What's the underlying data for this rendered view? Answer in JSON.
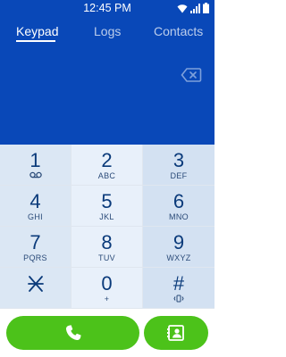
{
  "status_bar": {
    "time": "12:45 PM"
  },
  "tabs": [
    {
      "label": "Keypad"
    },
    {
      "label": "Logs"
    },
    {
      "label": "Contacts"
    }
  ],
  "dial": {
    "number": ""
  },
  "keys": [
    {
      "digit": "1",
      "letters": ""
    },
    {
      "digit": "2",
      "letters": "ABC"
    },
    {
      "digit": "3",
      "letters": "DEF"
    },
    {
      "digit": "4",
      "letters": "GHI"
    },
    {
      "digit": "5",
      "letters": "JKL"
    },
    {
      "digit": "6",
      "letters": "MNO"
    },
    {
      "digit": "7",
      "letters": "PQRS"
    },
    {
      "digit": "8",
      "letters": "TUV"
    },
    {
      "digit": "9",
      "letters": "WXYZ"
    },
    {
      "digit": "",
      "letters": ""
    },
    {
      "digit": "0",
      "letters": "+"
    },
    {
      "digit": "#",
      "letters": ""
    }
  ],
  "icons": {
    "wifi": "wifi-icon",
    "signal": "signal-icon",
    "battery": "battery-icon",
    "backspace": "backspace-icon",
    "voicemail": "voicemail-icon",
    "star": "star-icon",
    "vibrate": "vibrate-icon",
    "phone": "phone-icon",
    "contact": "add-contact-icon"
  },
  "colors": {
    "header_bg": "#0948b8",
    "call_green": "#4cc21a",
    "key_digit": "#0a3a7a"
  }
}
